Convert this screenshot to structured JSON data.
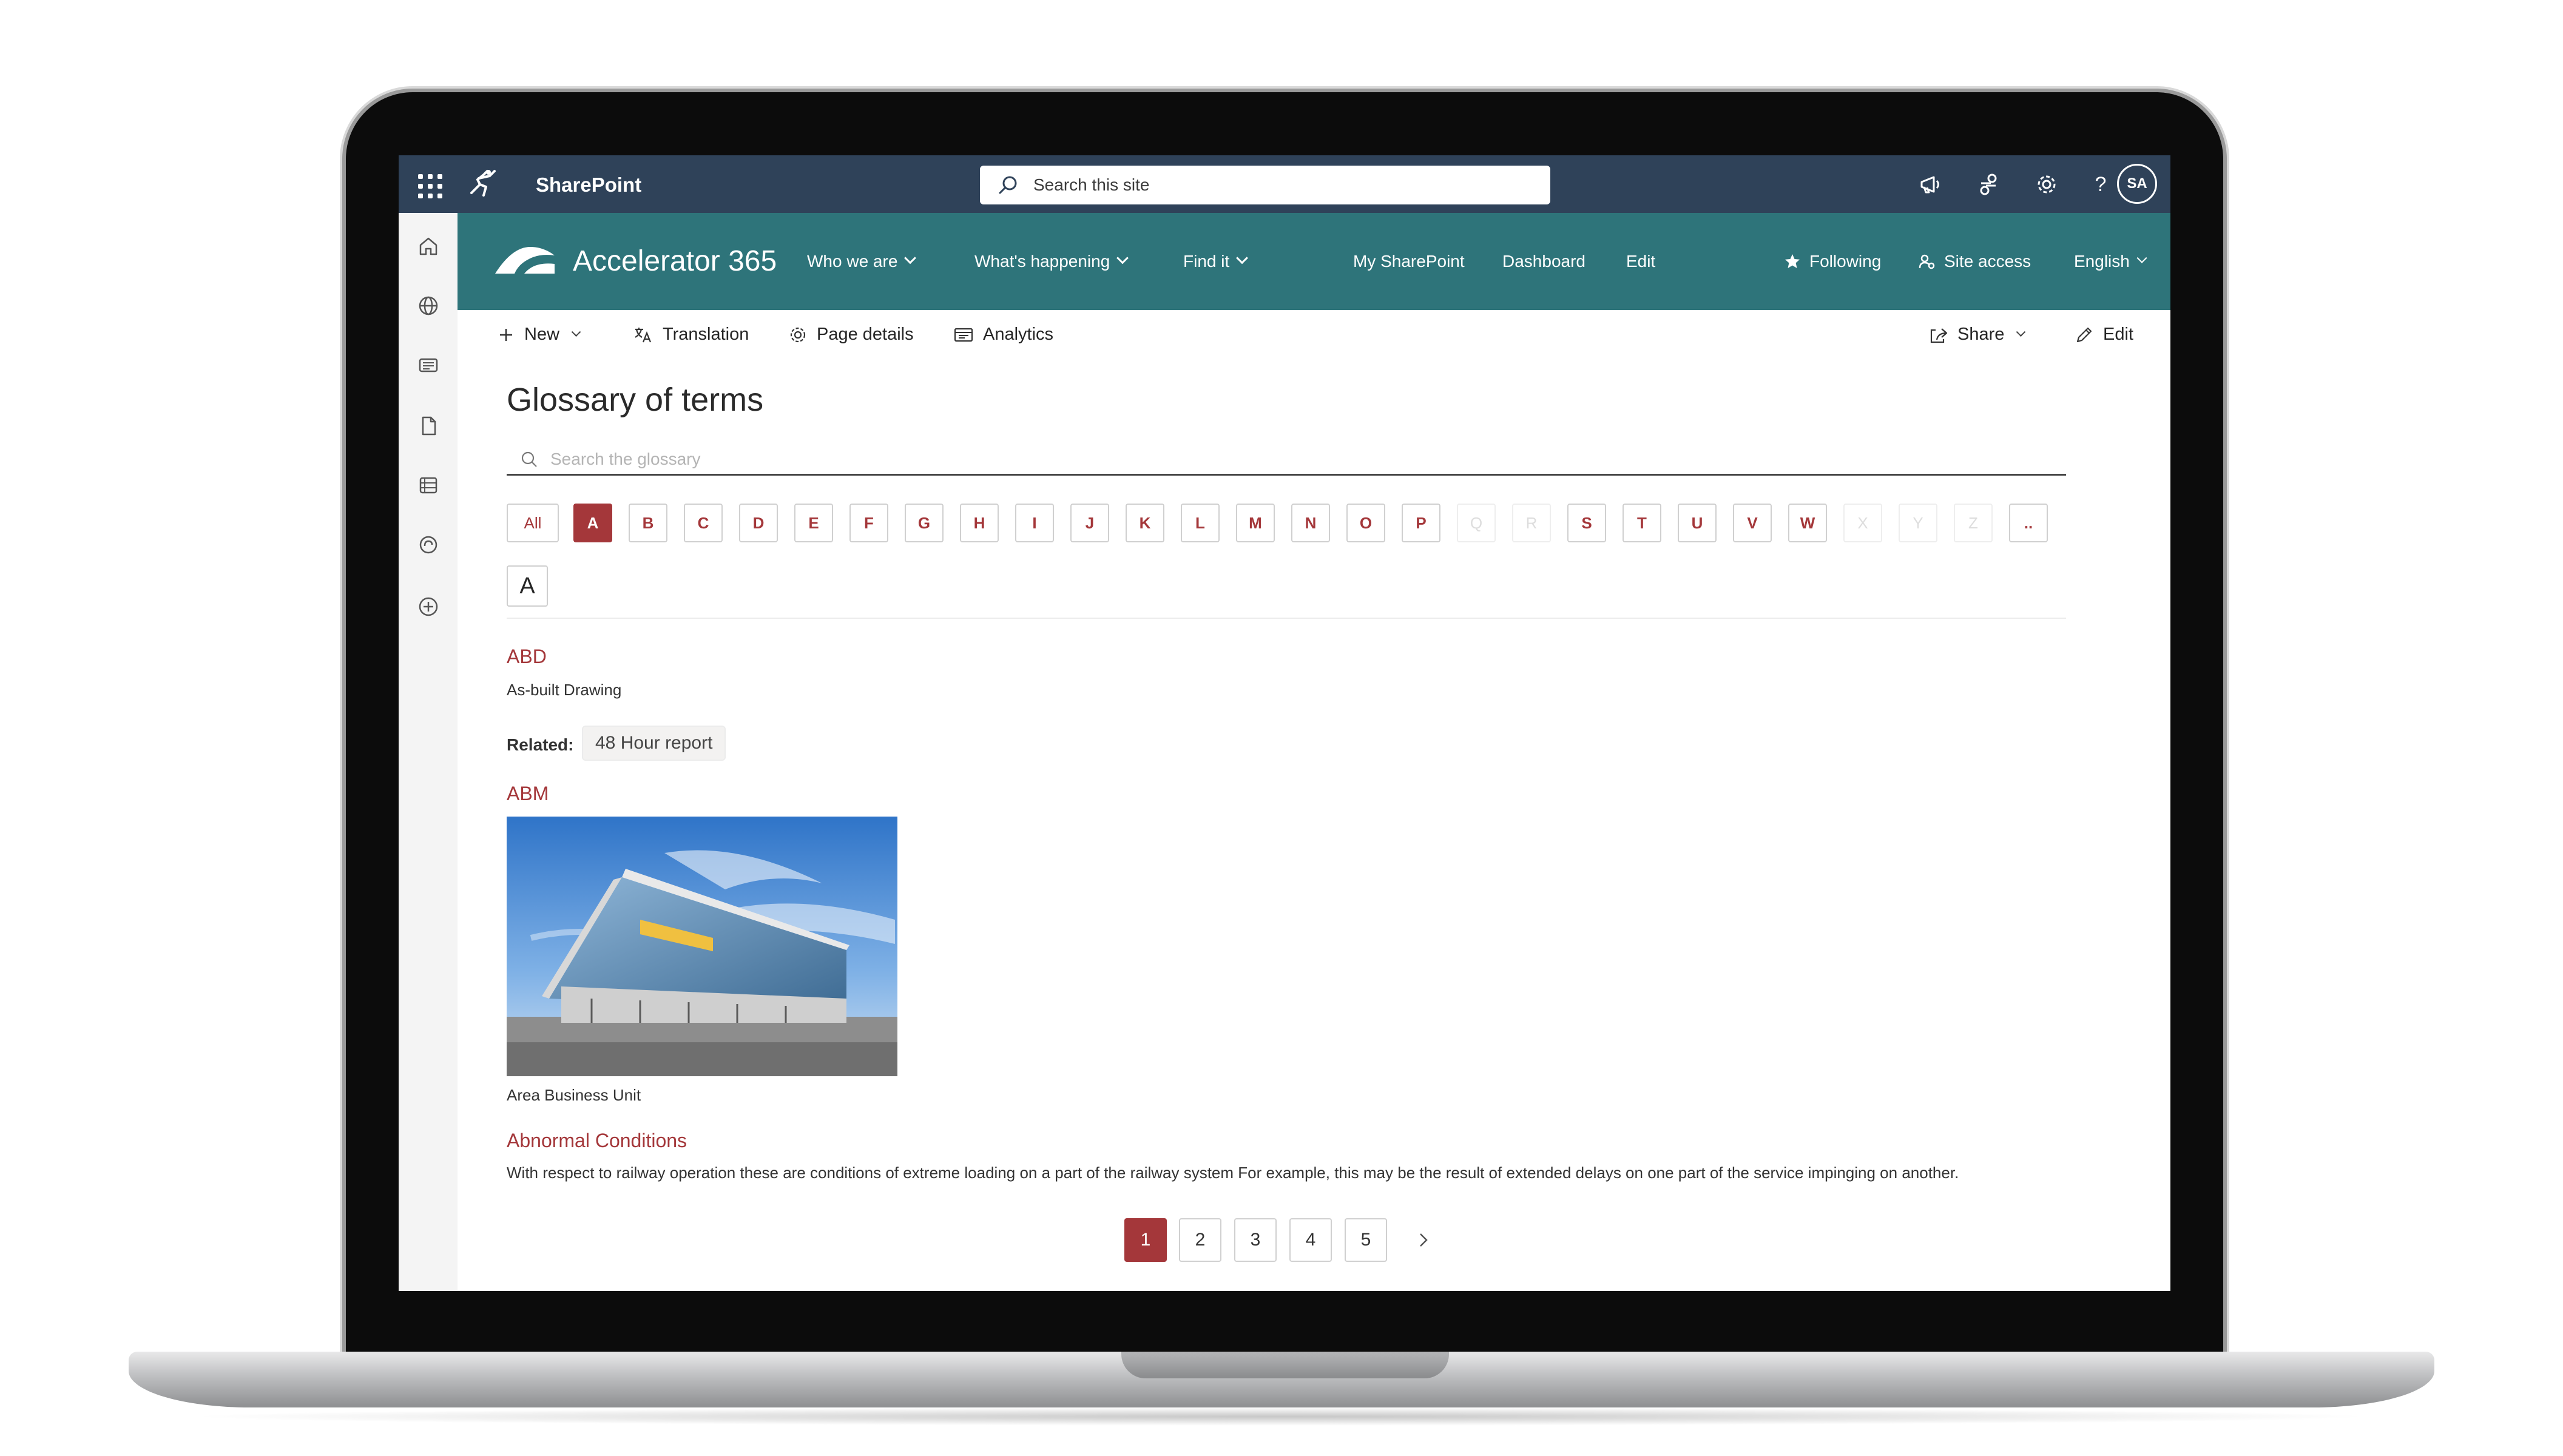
{
  "suite_bar": {
    "app_name": "SharePoint",
    "search_placeholder": "Search this site",
    "avatar_initials": "SA",
    "background_color": "#2f4259"
  },
  "hub_nav": {
    "site_title": "Accelerator 365",
    "items": [
      {
        "label": "Who we are",
        "has_dropdown": true
      },
      {
        "label": "What's happening",
        "has_dropdown": true
      },
      {
        "label": "Find it",
        "has_dropdown": true
      },
      {
        "label": "My SharePoint",
        "has_dropdown": false
      },
      {
        "label": "Dashboard",
        "has_dropdown": false
      },
      {
        "label": "Edit",
        "has_dropdown": false
      }
    ],
    "following_label": "Following",
    "site_access_label": "Site access",
    "language_label": "English",
    "background_color": "#2e747a"
  },
  "command_bar": {
    "new_label": "New",
    "translation_label": "Translation",
    "page_details_label": "Page details",
    "analytics_label": "Analytics",
    "share_label": "Share",
    "edit_label": "Edit"
  },
  "page": {
    "title": "Glossary of terms",
    "search_placeholder": "Search the glossary",
    "accent_color": "#a4373a",
    "letter_filters": [
      {
        "label": "All",
        "state": "enabled"
      },
      {
        "label": "A",
        "state": "active"
      },
      {
        "label": "B",
        "state": "enabled"
      },
      {
        "label": "C",
        "state": "enabled"
      },
      {
        "label": "D",
        "state": "enabled"
      },
      {
        "label": "E",
        "state": "enabled"
      },
      {
        "label": "F",
        "state": "enabled"
      },
      {
        "label": "G",
        "state": "enabled"
      },
      {
        "label": "H",
        "state": "enabled"
      },
      {
        "label": "I",
        "state": "enabled"
      },
      {
        "label": "J",
        "state": "enabled"
      },
      {
        "label": "K",
        "state": "enabled"
      },
      {
        "label": "L",
        "state": "enabled"
      },
      {
        "label": "M",
        "state": "enabled"
      },
      {
        "label": "N",
        "state": "enabled"
      },
      {
        "label": "O",
        "state": "enabled"
      },
      {
        "label": "P",
        "state": "enabled"
      },
      {
        "label": "Q",
        "state": "disabled"
      },
      {
        "label": "R",
        "state": "disabled"
      },
      {
        "label": "S",
        "state": "enabled"
      },
      {
        "label": "T",
        "state": "enabled"
      },
      {
        "label": "U",
        "state": "enabled"
      },
      {
        "label": "V",
        "state": "enabled"
      },
      {
        "label": "W",
        "state": "enabled"
      },
      {
        "label": "X",
        "state": "disabled"
      },
      {
        "label": "Y",
        "state": "disabled"
      },
      {
        "label": "Z",
        "state": "disabled"
      },
      {
        "label": "..",
        "state": "enabled"
      }
    ],
    "section_letter": "A",
    "terms": [
      {
        "title": "ABD",
        "description": "As-built Drawing",
        "related_label": "Related:",
        "related": [
          "48 Hour report"
        ]
      },
      {
        "title": "ABM",
        "description": "Area Business Unit",
        "image": "building-photo"
      },
      {
        "title": "Abnormal Conditions",
        "description": "With respect to railway operation these are conditions of extreme loading on a part of the railway system For example, this may be the result of extended delays on one part of the service impinging on another."
      }
    ],
    "pagination": {
      "pages": [
        "1",
        "2",
        "3",
        "4",
        "5"
      ],
      "current": "1"
    }
  }
}
